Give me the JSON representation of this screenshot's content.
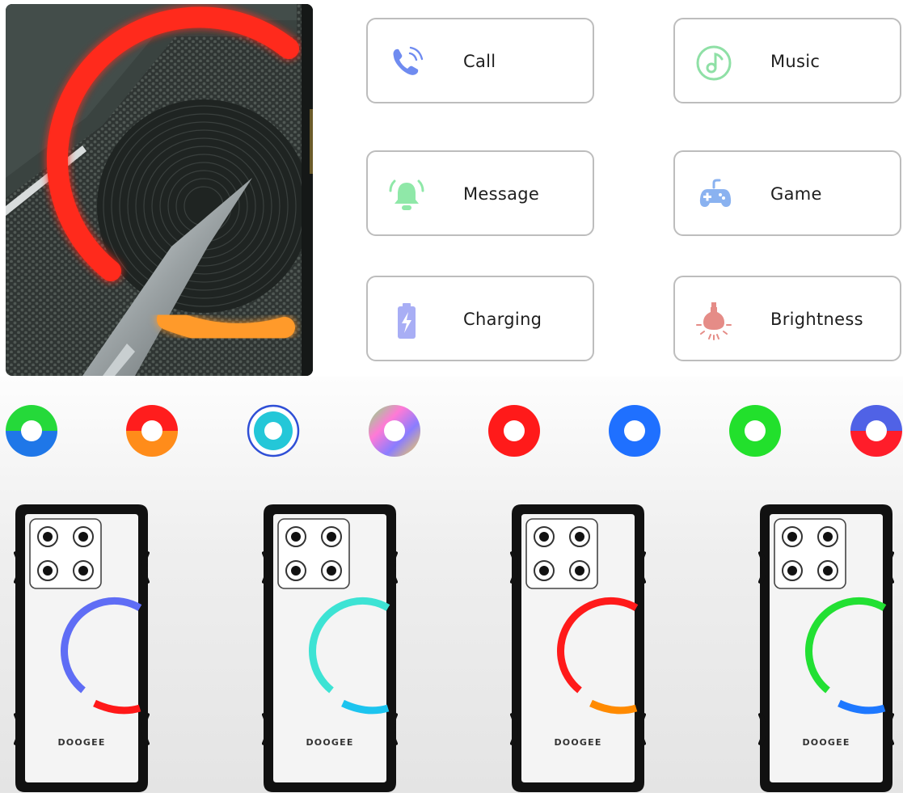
{
  "features": [
    {
      "id": "call",
      "label": "Call",
      "icon": "phone-icon",
      "color": "#6f8bf0"
    },
    {
      "id": "music",
      "label": "Music",
      "icon": "music-icon",
      "color": "#8fe0a6"
    },
    {
      "id": "message",
      "label": "Message",
      "icon": "bell-icon",
      "color": "#8fe8a8"
    },
    {
      "id": "game",
      "label": "Game",
      "icon": "gamepad-icon",
      "color": "#8ab2f0"
    },
    {
      "id": "charging",
      "label": "Charging",
      "icon": "battery-icon",
      "color": "#a8aef5"
    },
    {
      "id": "brightness",
      "label": "Brightness",
      "icon": "bulb-icon",
      "color": "#e58c87"
    }
  ],
  "phones": [
    {
      "brand": "DOOGEE",
      "ring_color": "#5f6df5",
      "arc_color": "#ff1818"
    },
    {
      "brand": "DOOGEE",
      "ring_color": "#3de3d4",
      "arc_color": "#1cc4ef"
    },
    {
      "brand": "DOOGEE",
      "ring_color": "#ff1a1a",
      "arc_color": "#ff8a00"
    },
    {
      "brand": "DOOGEE",
      "ring_color": "#22e033",
      "arc_color": "#1e78ff"
    }
  ]
}
